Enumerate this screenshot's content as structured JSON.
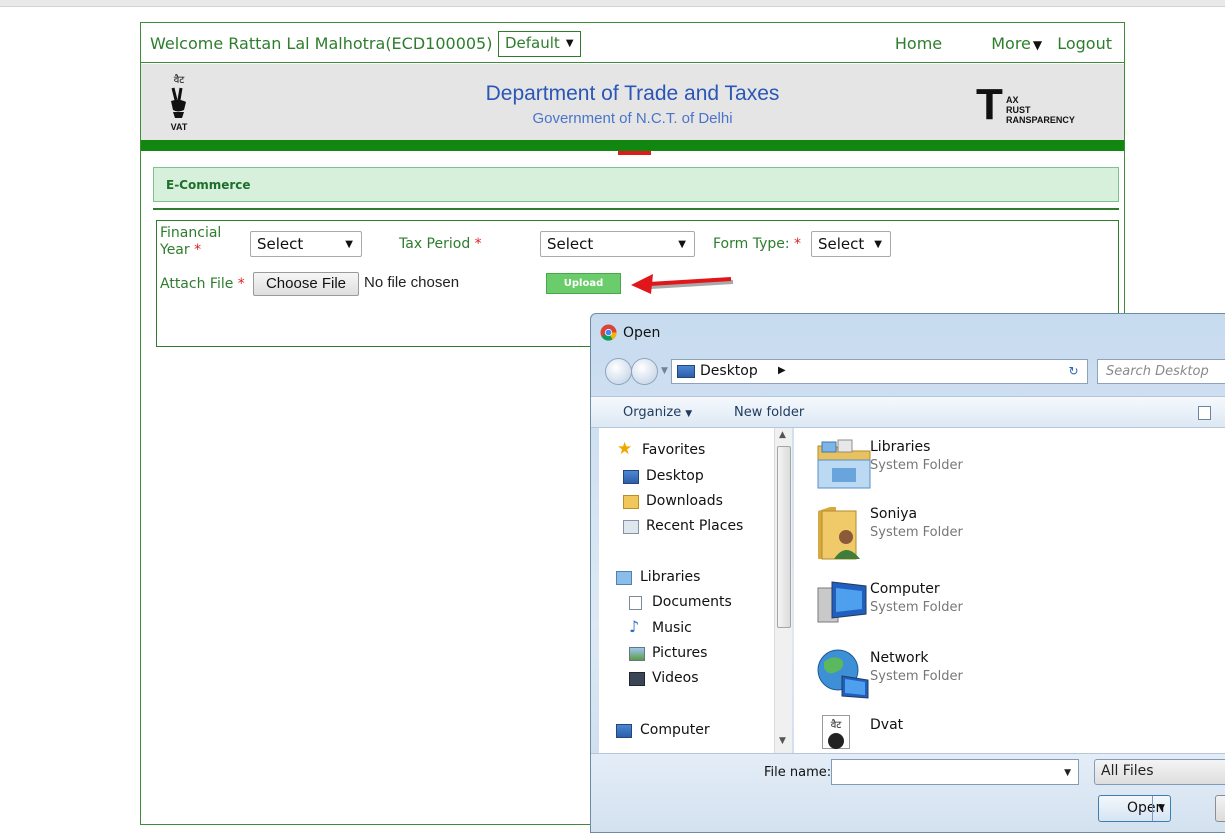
{
  "portal": {
    "welcome_text": "Welcome Rattan Lal Malhotra(ECD100005)",
    "profile_select": "Default",
    "nav": {
      "home": "Home",
      "more": "More",
      "logout": "Logout"
    },
    "vat_logo_top": "वैट",
    "vat_logo_bottom": "VAT",
    "department_title": "Department of Trade and Taxes",
    "department_subtitle": "Government of N.C.T. of Delhi",
    "ttt_logo": {
      "letter": "T",
      "line1": "AX",
      "line2": "RUST",
      "line3": "RANSPARENCY"
    },
    "section_title": "E-Commerce",
    "form": {
      "financial_year_label_1": "Financial",
      "financial_year_label_2": "Year",
      "financial_year_value": "Select",
      "tax_period_label": "Tax Period",
      "tax_period_value": "Select",
      "form_type_label": "Form Type:",
      "form_type_value": "Select",
      "attach_file_label": "Attach File",
      "choose_file_button": "Choose File",
      "no_file_text": "No file chosen",
      "upload_button": "Upload",
      "required_marker": "*"
    }
  },
  "dialog": {
    "title": "Open",
    "address": "Desktop",
    "search_placeholder": "Search Desktop",
    "toolbar": {
      "organize": "Organize",
      "new_folder": "New folder"
    },
    "nav_items": [
      {
        "label": "Favorites",
        "icon": "star-icon"
      },
      {
        "label": "Desktop",
        "icon": "desktop-icon"
      },
      {
        "label": "Downloads",
        "icon": "downloads-icon"
      },
      {
        "label": "Recent Places",
        "icon": "recent-places-icon"
      },
      {
        "label": "Libraries",
        "icon": "libraries-icon"
      },
      {
        "label": "Documents",
        "icon": "documents-icon"
      },
      {
        "label": "Music",
        "icon": "music-icon"
      },
      {
        "label": "Pictures",
        "icon": "pictures-icon"
      },
      {
        "label": "Videos",
        "icon": "videos-icon"
      },
      {
        "label": "Computer",
        "icon": "computer-icon"
      }
    ],
    "files": [
      {
        "name": "Libraries",
        "type": "System Folder",
        "icon": "libraries-folder-icon"
      },
      {
        "name": "Soniya",
        "type": "System Folder",
        "icon": "user-folder-icon"
      },
      {
        "name": "Computer",
        "type": "System Folder",
        "icon": "computer-icon"
      },
      {
        "name": "Network",
        "type": "System Folder",
        "icon": "network-icon"
      },
      {
        "name": "Dvat",
        "type": "",
        "icon": "dvat-shortcut-icon",
        "icon_text": "वैट"
      }
    ],
    "file_name_label": "File name:",
    "file_name_value": "",
    "file_type_value": "All Files",
    "open_button": "Open"
  }
}
